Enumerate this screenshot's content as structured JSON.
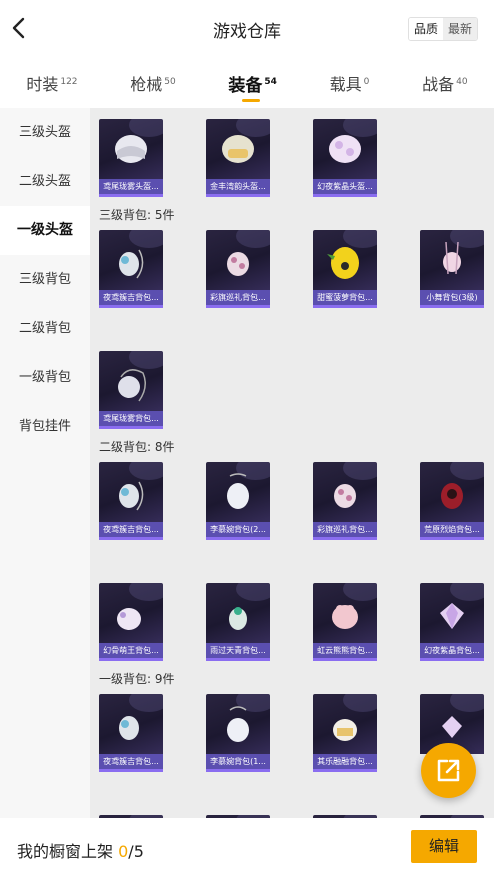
{
  "header": {
    "title": "游戏仓库",
    "sort_quality": "品质",
    "sort_latest": "最新"
  },
  "tabs": [
    {
      "label": "时装",
      "count": "122"
    },
    {
      "label": "枪械",
      "count": "50"
    },
    {
      "label": "装备",
      "count": "54"
    },
    {
      "label": "载具",
      "count": "0"
    },
    {
      "label": "战备",
      "count": "40"
    }
  ],
  "sidebar": [
    {
      "label": "三级头盔"
    },
    {
      "label": "二级头盔"
    },
    {
      "label": "一级头盔"
    },
    {
      "label": "三级背包"
    },
    {
      "label": "二级背包"
    },
    {
      "label": "一级背包"
    },
    {
      "label": "背包挂件"
    }
  ],
  "sections": {
    "level3_backpack": "三级背包: 5件",
    "level2_backpack": "二级背包: 8件",
    "level1_backpack": "一级背包: 9件"
  },
  "items": {
    "helmets": [
      "鸢尾珑雾头盔...",
      "金丰湾韵头盔...",
      "幻夜紫晶头盔..."
    ],
    "level3": [
      "夜鸢簇吉背包...",
      "彩旗巡礼背包...",
      "甜蜜菠萝背包...",
      "小舞背包(3级)",
      "鸢尾珑雾背包..."
    ],
    "level2": [
      "夜鸢簇吉背包...",
      "李慕婉背包(2...",
      "彩旗巡礼背包...",
      "荒原烈焰背包...",
      "幻骨萌王背包...",
      "雨过天青背包...",
      "虹云熊熊背包...",
      "幻夜紫晶背包..."
    ],
    "level1": [
      "夜鸢簇吉背包...",
      "李慕婉背包(1...",
      "其乐融融背包..."
    ]
  },
  "bottom": {
    "label": "我的橱窗上架",
    "current": "0",
    "total": "/5",
    "edit": "编辑"
  },
  "colors": {
    "accent": "#f5a800",
    "card_label": "#5b4fb0",
    "card_bg": "#1c1830"
  }
}
